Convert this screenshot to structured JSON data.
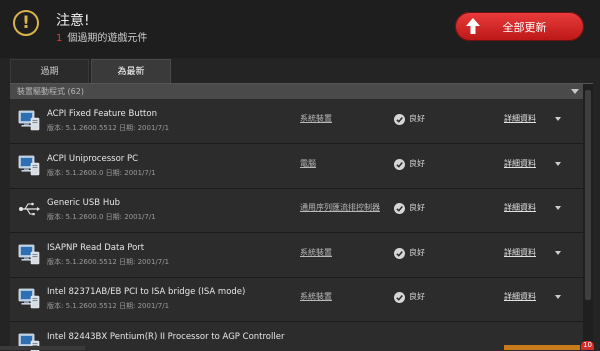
{
  "header": {
    "title": "注意!",
    "subtitle_count": "1",
    "subtitle_text": "個過期的遊戲元件",
    "update_all_label": "全部更新",
    "warning_symbol": "!"
  },
  "tabs": [
    {
      "label": "過期",
      "active": false
    },
    {
      "label": "為最新",
      "active": true
    }
  ],
  "section": {
    "label": "裝置驅動程式 (62)"
  },
  "rows": [
    {
      "name": "ACPI Fixed Feature Button",
      "version": "版本: 5.1.2600.5512   日期: 2001/7/1",
      "category": "系統裝置",
      "status": "良好",
      "details": "詳細資料",
      "icon": "computer-monitor-icon"
    },
    {
      "name": "ACPI Uniprocessor PC",
      "version": "版本: 5.1.2600.0   日期: 2001/7/1",
      "category": "電腦",
      "status": "良好",
      "details": "詳細資料",
      "icon": "computer-monitor-icon"
    },
    {
      "name": "Generic USB Hub",
      "version": "版本: 5.1.2600.0   日期: 2001/7/1",
      "category": "通用序列匯流排控制器",
      "status": "良好",
      "details": "詳細資料",
      "icon": "usb-icon"
    },
    {
      "name": "ISAPNP Read Data Port",
      "version": "版本: 5.1.2600.5512   日期: 2001/7/1",
      "category": "系統裝置",
      "status": "良好",
      "details": "詳細資料",
      "icon": "computer-monitor-icon"
    },
    {
      "name": "Intel 82371AB/EB PCI to ISA bridge (ISA mode)",
      "version": "版本: 5.1.2600.5512   日期: 2001/7/1",
      "category": "系統裝置",
      "status": "良好",
      "details": "詳細資料",
      "icon": "computer-monitor-icon"
    },
    {
      "name": "Intel 82443BX Pentium(R) II Processor to AGP Controller",
      "version": "",
      "category": "",
      "status": "",
      "details": "",
      "icon": "computer-monitor-icon"
    }
  ],
  "footer": {
    "badge": "10"
  },
  "colors": {
    "accent": "#d62b2b",
    "warning": "#d9b34a",
    "background": "#242424"
  }
}
